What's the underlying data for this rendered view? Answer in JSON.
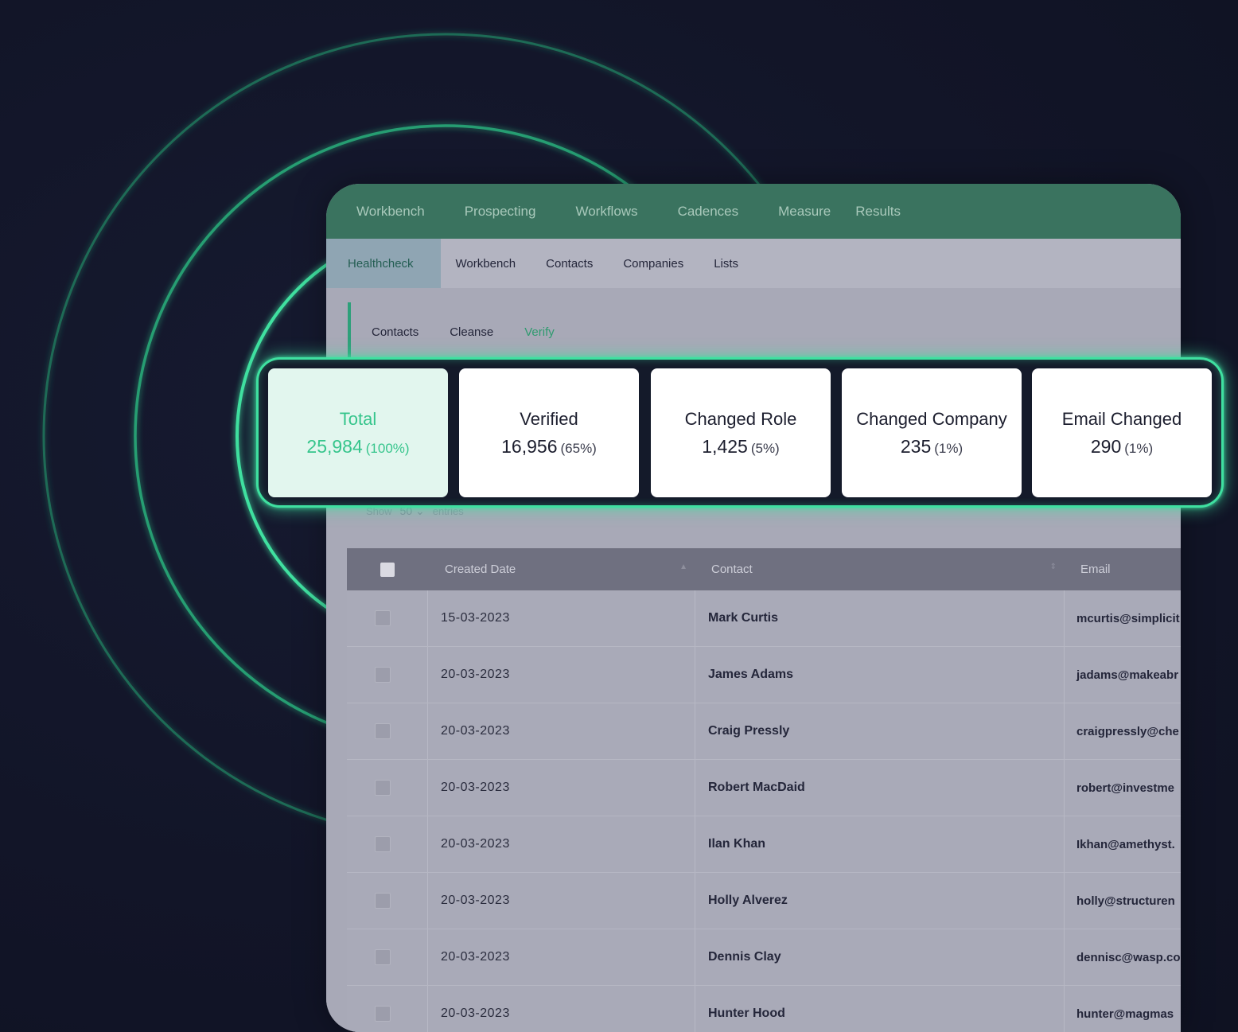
{
  "top_nav": [
    "Workbench",
    "Prospecting",
    "Workflows",
    "Cadences",
    "Measure",
    "Results"
  ],
  "sub_nav": [
    "Healthcheck",
    "Workbench",
    "Contacts",
    "Companies",
    "Lists"
  ],
  "tertiary_nav": [
    "Contacts",
    "Cleanse",
    "Verify"
  ],
  "stats": [
    {
      "label": "Total",
      "value": "25,984",
      "pct": "(100%)"
    },
    {
      "label": "Verified",
      "value": "16,956",
      "pct": "(65%)"
    },
    {
      "label": "Changed Role",
      "value": "1,425",
      "pct": "(5%)"
    },
    {
      "label": "Changed Company",
      "value": "235",
      "pct": "(1%)"
    },
    {
      "label": "Email Changed",
      "value": "290",
      "pct": "(1%)"
    }
  ],
  "show_entries": {
    "show": "Show",
    "value": "50",
    "entries": "entries"
  },
  "table": {
    "headers": {
      "created_date": "Created Date",
      "contact": "Contact",
      "email": "Email"
    },
    "rows": [
      {
        "date": "15-03-2023",
        "contact": "Mark Curtis",
        "email": "mcurtis@simplicit"
      },
      {
        "date": "20-03-2023",
        "contact": "James Adams",
        "email": "jadams@makeabr"
      },
      {
        "date": "20-03-2023",
        "contact": "Craig Pressly",
        "email": "craigpressly@che"
      },
      {
        "date": "20-03-2023",
        "contact": "Robert MacDaid",
        "email": "robert@investme"
      },
      {
        "date": "20-03-2023",
        "contact": "Ilan Khan",
        "email": "Ikhan@amethyst."
      },
      {
        "date": "20-03-2023",
        "contact": "Holly Alverez",
        "email": "holly@structuren"
      },
      {
        "date": "20-03-2023",
        "contact": "Dennis Clay",
        "email": "dennisc@wasp.co"
      },
      {
        "date": "20-03-2023",
        "contact": "Hunter Hood",
        "email": "hunter@magmas"
      }
    ]
  },
  "colors": {
    "accent": "#3fe0a0",
    "nav_green": "#3a735f",
    "background": "#121528",
    "active_text": "#36c58c"
  }
}
